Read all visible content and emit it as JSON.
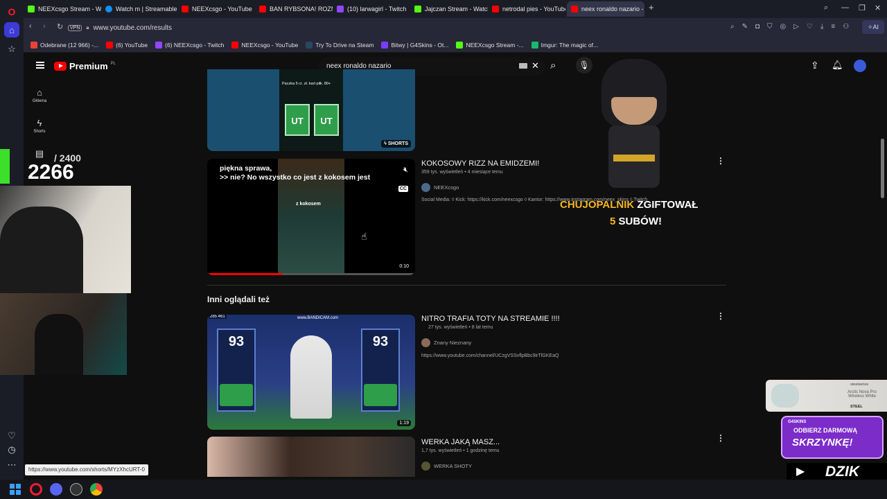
{
  "tabs": [
    {
      "title": "NEEXcsgo Stream - Watch",
      "color": "#53fc18"
    },
    {
      "title": "Watch m | Streamable",
      "color": "#0f90fa"
    },
    {
      "title": "NEEXcsgo - YouTube",
      "color": "#ff0000"
    },
    {
      "title": "BAN RYBSONA! ROZMAW",
      "color": "#ff0000"
    },
    {
      "title": "(10) larwagirl - Twitch",
      "color": "#9146ff"
    },
    {
      "title": "Jajczan Stream - Watch L",
      "color": "#53fc18"
    },
    {
      "title": "netrodal pies - YouTube",
      "color": "#ff0000"
    },
    {
      "title": "neex ronaldo nazario - Yo",
      "color": "#ff0000"
    }
  ],
  "address": {
    "vpn": "VPN",
    "url": "www.youtube.com/results"
  },
  "bookmarks": [
    {
      "label": "Odebrane (12 966) -...",
      "color": "#ea4335"
    },
    {
      "label": "(6) YouTube",
      "color": "#ff0000"
    },
    {
      "label": "(6) NEEXcsgo - Twitch",
      "color": "#9146ff"
    },
    {
      "label": "NEEXcsgo - YouTube",
      "color": "#ff0000"
    },
    {
      "label": "Try To Drive na Steam",
      "color": "#2a475e"
    },
    {
      "label": "Bitwy | G4Skins - Ot...",
      "color": "#7a3cff"
    },
    {
      "label": "NEEXcsgo Stream -...",
      "color": "#53fc18"
    },
    {
      "label": "Imgur: The magic of...",
      "color": "#1bb76e"
    }
  ],
  "yt": {
    "logo": "Premium",
    "country": "PL",
    "search_query": "neex ronaldo nazario",
    "rail": [
      {
        "icon": "home-icon",
        "label": "Główna"
      },
      {
        "icon": "shorts-icon",
        "label": "Shorts"
      },
      {
        "icon": "subscriptions-icon",
        "label": "Subskrypcje"
      }
    ]
  },
  "results": {
    "shorts_badge": "SHORTS",
    "short_caption": "Paczka 5 rz. zł. kart piłk. 80+",
    "video1": {
      "title": "KOKOSOWY RIZZ NA EMIDZEMI!",
      "meta": "359 tys. wyświetleń • 4 miesiące temu",
      "channel": "NEEXcsgo",
      "desc": "Social Media: ◊ Kick: https://kick.com/neexcsgo ◊ Kantor: https://www.instagram.com/neex_skins ◊ Twitch",
      "overlay_line1": "piękna sprawa,",
      "overlay_line2": ">> nie? No wszystko co jest z kokosem jest",
      "overlay_small": "z kokosem",
      "duration": "0:10",
      "progress": 0.36
    },
    "section": "Inni oglądali też",
    "video2": {
      "title": "NITRO TRAFIA TOTY NA STREAMIE !!!!",
      "meta": "27 tys. wyświetleń • 8 lat temu",
      "channel": "Znany Nieznany",
      "desc": "https://www.youtube.com/channel/UCzgVSSvflpBbc9irTlGKEaQ",
      "watermark": "www.BANDICAM.com",
      "counter": "285 461",
      "duration": "1:19"
    },
    "video3": {
      "title": "WERKA JAKĄ MASZ...",
      "meta": "1,7 tys. wyświetleń • 1 godzinę temu",
      "channel": "WERKA SHOTY"
    }
  },
  "stream": {
    "goal_label": "/ 2400",
    "goal_count": "2266",
    "gift_name": "CHUJOPALNIK",
    "gift_text": "ZGIFTOWAŁ",
    "gift_count": "5",
    "gift_subs": "SUBÓW!",
    "ad_brand": "steelseries",
    "ad_product": "Arctis Nova Pro Wireless White",
    "ad_tag": "STEEL",
    "case_brand": "G4SKINS",
    "case_line1": "ODBIERZ DARMOWĄ",
    "case_line2": "SKRZYNKĘ!",
    "sponsor": "DZIK"
  },
  "status_url": "https://www.youtube.com/shorts/MYzXhcURT-0"
}
